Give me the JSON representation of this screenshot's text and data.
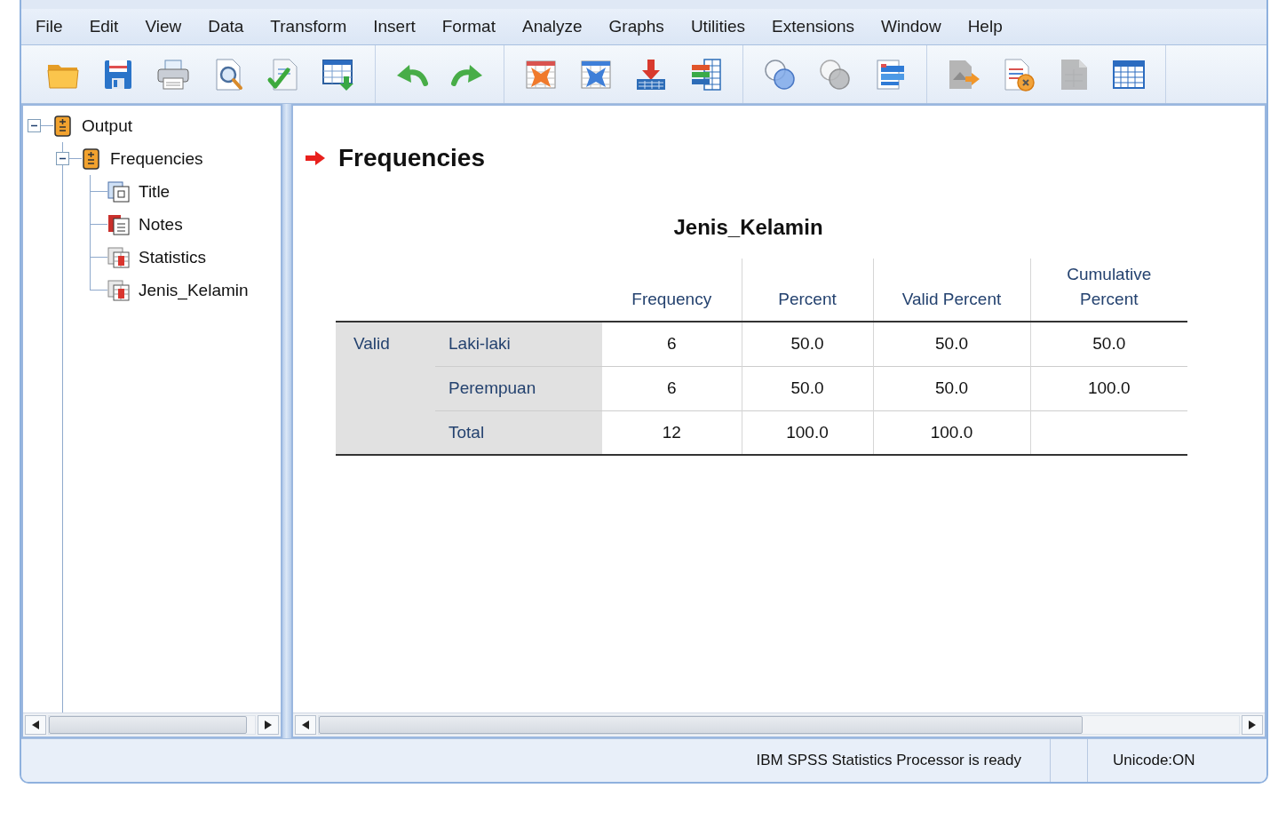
{
  "menu": [
    {
      "label": "File"
    },
    {
      "label": "Edit"
    },
    {
      "label": "View"
    },
    {
      "label": "Data"
    },
    {
      "label": "Transform"
    },
    {
      "label": "Insert"
    },
    {
      "label": "Format"
    },
    {
      "label": "Analyze"
    },
    {
      "label": "Graphs"
    },
    {
      "label": "Utilities"
    },
    {
      "label": "Extensions"
    },
    {
      "label": "Window"
    },
    {
      "label": "Help"
    }
  ],
  "toolbar": [
    [
      {
        "kind": "open",
        "disabled": false
      },
      {
        "kind": "save",
        "disabled": false
      },
      {
        "kind": "print",
        "disabled": false
      },
      {
        "kind": "preview",
        "disabled": false
      },
      {
        "kind": "export",
        "disabled": false
      },
      {
        "kind": "dataset",
        "disabled": false
      }
    ],
    [
      {
        "kind": "undo",
        "disabled": false
      },
      {
        "kind": "redo",
        "disabled": false
      }
    ],
    [
      {
        "kind": "pivot",
        "disabled": false
      },
      {
        "kind": "swap",
        "disabled": false
      },
      {
        "kind": "insert",
        "disabled": false
      },
      {
        "kind": "bars",
        "disabled": false
      }
    ],
    [
      {
        "kind": "venn",
        "disabled": false
      },
      {
        "kind": "venn",
        "disabled": true
      },
      {
        "kind": "stack",
        "disabled": false
      }
    ],
    [
      {
        "kind": "promote",
        "disabled": false
      },
      {
        "kind": "script",
        "disabled": false
      },
      {
        "kind": "page",
        "disabled": true
      },
      {
        "kind": "grid",
        "disabled": false
      }
    ]
  ],
  "tree": [
    {
      "label": "Output",
      "kind": "log",
      "expanded": true,
      "children": [
        {
          "label": "Frequencies",
          "kind": "log",
          "expanded": true,
          "children": [
            {
              "label": "Title",
              "kind": "title"
            },
            {
              "label": "Notes",
              "kind": "notes"
            },
            {
              "label": "Statistics",
              "kind": "table"
            },
            {
              "label": "Jenis_Kelamin",
              "kind": "table"
            }
          ]
        }
      ]
    }
  ],
  "output": {
    "heading": {
      "text": "Frequencies",
      "current": true
    },
    "table": {
      "title": "Jenis_Kelamin",
      "columns": [
        "Frequency",
        "Percent",
        "Valid Percent",
        "Cumulative Percent"
      ],
      "row_group": "Valid",
      "rows": [
        {
          "label": "Laki-laki",
          "cells": [
            "6",
            "50.0",
            "50.0",
            "50.0"
          ]
        },
        {
          "label": "Perempuan",
          "cells": [
            "6",
            "50.0",
            "50.0",
            "100.0"
          ]
        },
        {
          "label": "Total",
          "cells": [
            "12",
            "100.0",
            "100.0"
          ]
        }
      ]
    }
  },
  "status_bar": {
    "message": "IBM SPSS Statistics Processor is ready",
    "encoding": "Unicode:ON"
  }
}
